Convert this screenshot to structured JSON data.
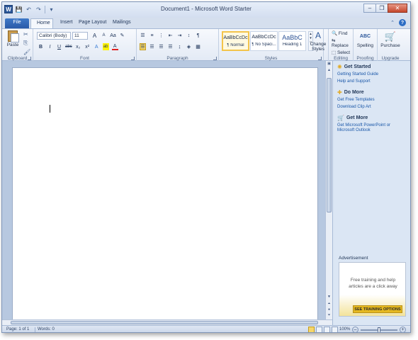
{
  "window": {
    "title": "Document1 - Microsoft Word Starter",
    "logo": "W",
    "controls": {
      "minimize": "–",
      "restore": "❐",
      "close": "✕"
    }
  },
  "quick_access": {
    "save_icon": "💾",
    "undo_icon": "↶",
    "redo_icon": "↷",
    "customize_icon": "▾"
  },
  "tabs": [
    {
      "label": "File"
    },
    {
      "label": "Home"
    },
    {
      "label": "Insert"
    },
    {
      "label": "Page Layout"
    },
    {
      "label": "Mailings"
    }
  ],
  "ribbon": {
    "clipboard": {
      "label": "Clipboard",
      "paste": "Paste"
    },
    "font": {
      "label": "Font",
      "family": "Calibri (Body)",
      "size": "11",
      "grow": "A",
      "shrink": "A",
      "case": "Aa",
      "clear": "✎",
      "bold": "B",
      "italic": "I",
      "underline": "U",
      "strike": "abc",
      "sub": "x₂",
      "sup": "x²",
      "effects": "A",
      "highlight": "ab",
      "color": "A"
    },
    "paragraph": {
      "label": "Paragraph"
    },
    "styles": {
      "label": "Styles",
      "items": [
        {
          "preview": "AaBbCcDc",
          "name": "¶ Normal"
        },
        {
          "preview": "AaBbCcDc",
          "name": "¶ No Spaci..."
        },
        {
          "preview": "AaBbC",
          "name": "Heading 1"
        }
      ],
      "change": "Change Styles"
    },
    "editing": {
      "label": "Editing",
      "find": "Find",
      "replace": "Replace",
      "select": "Select"
    },
    "proofing": {
      "label": "Proofing",
      "spelling": "Spelling",
      "spell_icon": "ABC"
    },
    "upgrade": {
      "label": "Upgrade",
      "purchase": "Purchase"
    }
  },
  "sidepane": {
    "get_started": {
      "title": "Get Started",
      "links": [
        "Getting Started Guide",
        "Help and Support"
      ]
    },
    "do_more": {
      "title": "Do More",
      "links": [
        "Get Free Templates",
        "Download Clip Art"
      ]
    },
    "get_more": {
      "title": "Get More",
      "links": [
        "Get Microsoft PowerPoint or Microsoft Outlook"
      ]
    },
    "ad_label": "Advertisement",
    "ad_text": "Free training and help articles are a click away",
    "ad_cta": "SEE TRAINING OPTIONS"
  },
  "status": {
    "page": "Page: 1 of 1",
    "words": "Words: 0",
    "zoom": "100%"
  }
}
